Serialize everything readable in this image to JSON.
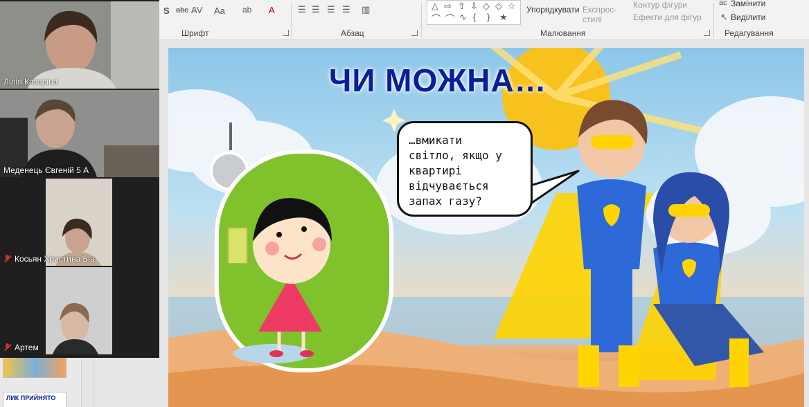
{
  "ribbon": {
    "groups": {
      "font": "Шрифт",
      "paragraph": "Абзац",
      "drawing": "Малювання",
      "editing": "Редагування"
    },
    "buttons": {
      "arrange": "Упорядкувати",
      "quick_styles": "Експрес-\nстилі",
      "shape_outline": "Контур фігури",
      "shape_effects": "Ефекти для фігур",
      "replace": "Замінити",
      "select": "Виділити"
    }
  },
  "participants": [
    {
      "name": "Лілія Казаріна",
      "muted": false,
      "active": true
    },
    {
      "name": "Меденець Євгеній 5 А",
      "muted": false,
      "active": false
    },
    {
      "name": "Косьян Христина 5-а",
      "muted": true,
      "active": false
    },
    {
      "name": "Артем",
      "muted": true,
      "active": false
    }
  ],
  "thumbnail_label": "ЛИК ПРИЙНЯТО",
  "slide": {
    "title": "ЧИ МОЖНА…",
    "bubble_text": "…вмикати\nсвітло, якщо у\nквартирі\nвідчувається\nзапах газу?"
  },
  "colors": {
    "title": "#0a1e9a",
    "active_tile": "#9bd54a",
    "muted_mic": "#d03030"
  }
}
